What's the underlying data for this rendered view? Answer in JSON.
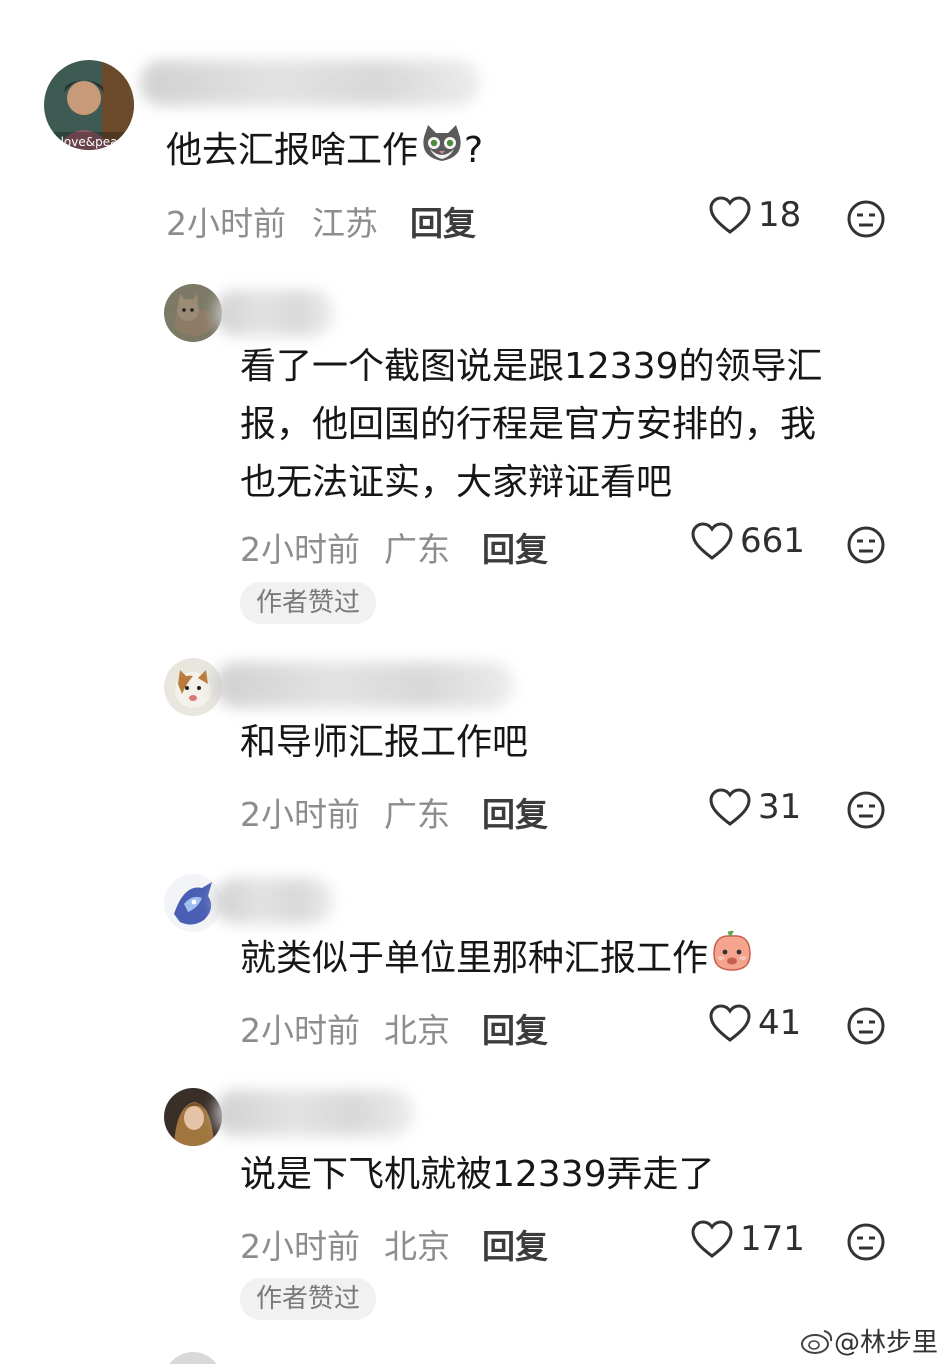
{
  "comments": [
    {
      "id": "c1",
      "avatar_icon": "user-avatar-photo",
      "avatar_caption": "love&pea",
      "text": "他去汇报啥工作",
      "text_suffix": "?",
      "emoji": "cat-face-emoji",
      "time": "2小时前",
      "location": "江苏",
      "reply_label": "回复",
      "likes": "18"
    },
    {
      "id": "c2",
      "avatar_icon": "cat-avatar",
      "lines": [
        "看了一个截图说是跟12339的领导汇",
        "报，他回国的行程是官方安排的，我",
        "也无法证实，大家辩证看吧"
      ],
      "time": "2小时前",
      "location": "广东",
      "reply_label": "回复",
      "likes": "661",
      "badge": "作者赞过"
    },
    {
      "id": "c3",
      "avatar_icon": "cat-avatar",
      "text": "和导师汇报工作吧",
      "time": "2小时前",
      "location": "广东",
      "reply_label": "回复",
      "likes": "31"
    },
    {
      "id": "c4",
      "avatar_icon": "anime-avatar",
      "text": "就类似于单位里那种汇报工作",
      "emoji": "peach-face-emoji",
      "time": "2小时前",
      "location": "北京",
      "reply_label": "回复",
      "likes": "41"
    },
    {
      "id": "c5",
      "avatar_icon": "portrait-avatar",
      "text": "说是下飞机就被12339弄走了",
      "time": "2小时前",
      "location": "北京",
      "reply_label": "回复",
      "likes": "171",
      "badge": "作者赞过"
    }
  ],
  "watermark": {
    "text": "@林步里",
    "icon": "weibo-icon"
  },
  "colors": {
    "meta_text": "#8d8d8d",
    "badge_bg": "#f1f1f1",
    "content_text": "#161616"
  }
}
